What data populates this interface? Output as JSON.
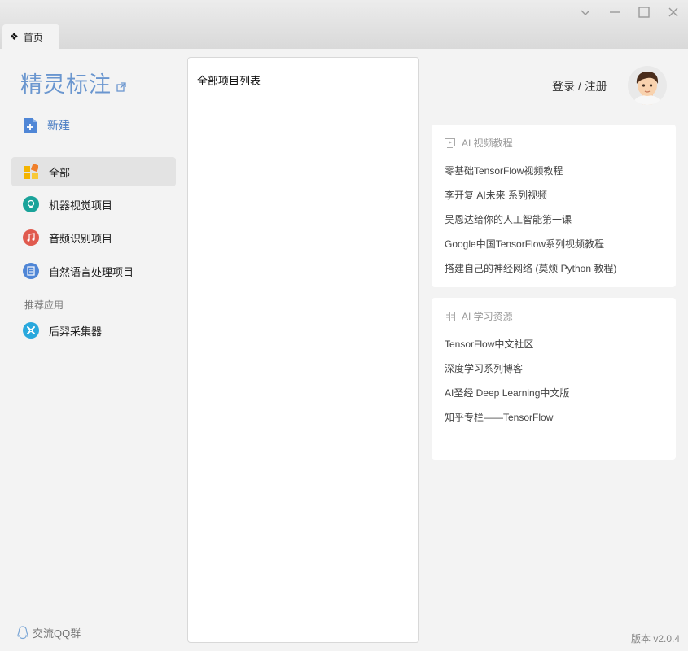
{
  "window": {
    "tab_label": "首页",
    "controls": [
      "chevron-down-icon",
      "minimize-icon",
      "maximize-icon",
      "close-icon"
    ]
  },
  "sidebar": {
    "brand": "精灵标注",
    "new_label": "新建",
    "items": [
      {
        "label": "全部",
        "icon": "grid-icon",
        "active": true
      },
      {
        "label": "机器视觉项目",
        "icon": "bulb-icon",
        "color": "#1aa39a"
      },
      {
        "label": "音频识别项目",
        "icon": "music-icon",
        "color": "#e05a4e"
      },
      {
        "label": "自然语言处理项目",
        "icon": "document-icon",
        "color": "#4f86d6"
      }
    ],
    "recommend_label": "推荐应用",
    "apps": [
      {
        "label": "后羿采集器",
        "icon": "collector-icon",
        "color": "#29a8dd"
      }
    ],
    "qq_label": "交流QQ群"
  },
  "projects": {
    "title": "全部项目列表"
  },
  "user": {
    "login_label": "登录 / 注册"
  },
  "video_card": {
    "title": "AI 视频教程",
    "links": [
      "零基础TensorFlow视频教程",
      "李开复 AI未来 系列视频",
      "吴恩达给你的人工智能第一课",
      "Google中国TensorFlow系列视频教程",
      "搭建自己的神经网络 (莫烦 Python 教程)"
    ]
  },
  "resource_card": {
    "title": "AI 学习资源",
    "links": [
      "TensorFlow中文社区",
      "深度学习系列博客",
      "AI圣经 Deep Learning中文版",
      "知乎专栏——TensorFlow"
    ]
  },
  "footer": {
    "version": "版本 v2.0.4"
  }
}
